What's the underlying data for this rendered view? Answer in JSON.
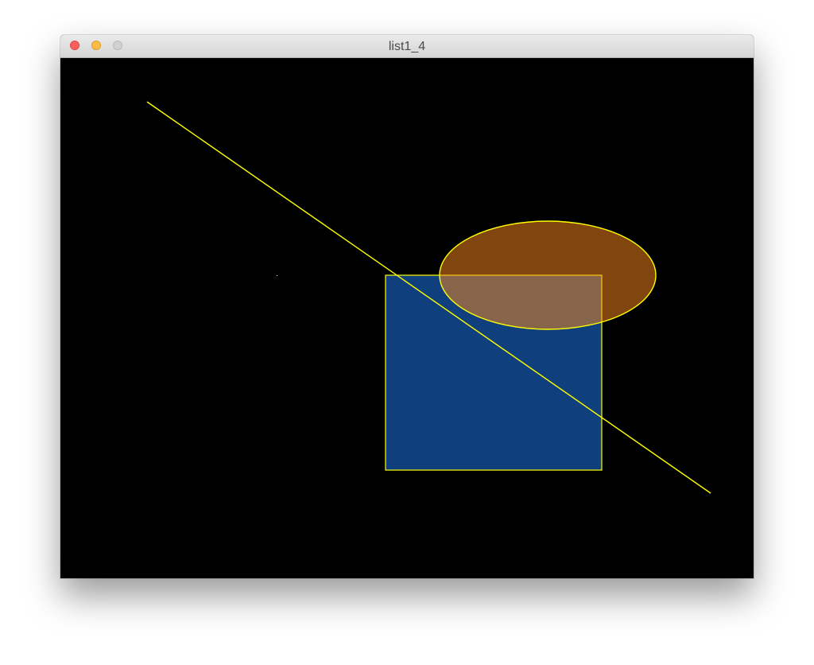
{
  "window": {
    "title": "list1_4"
  },
  "canvas": {
    "background_color": "#000000",
    "stroke_color": "#ffff00",
    "shapes": [
      {
        "type": "line",
        "stroke": "#ffff00"
      },
      {
        "type": "point",
        "color": "#ffffff"
      },
      {
        "type": "rectangle",
        "fill": "#0f3f7d",
        "stroke": "#ffff00"
      },
      {
        "type": "ellipse",
        "fill": "#ff8c1a",
        "fill_opacity": 0.5,
        "stroke": "#ffff00"
      }
    ]
  }
}
